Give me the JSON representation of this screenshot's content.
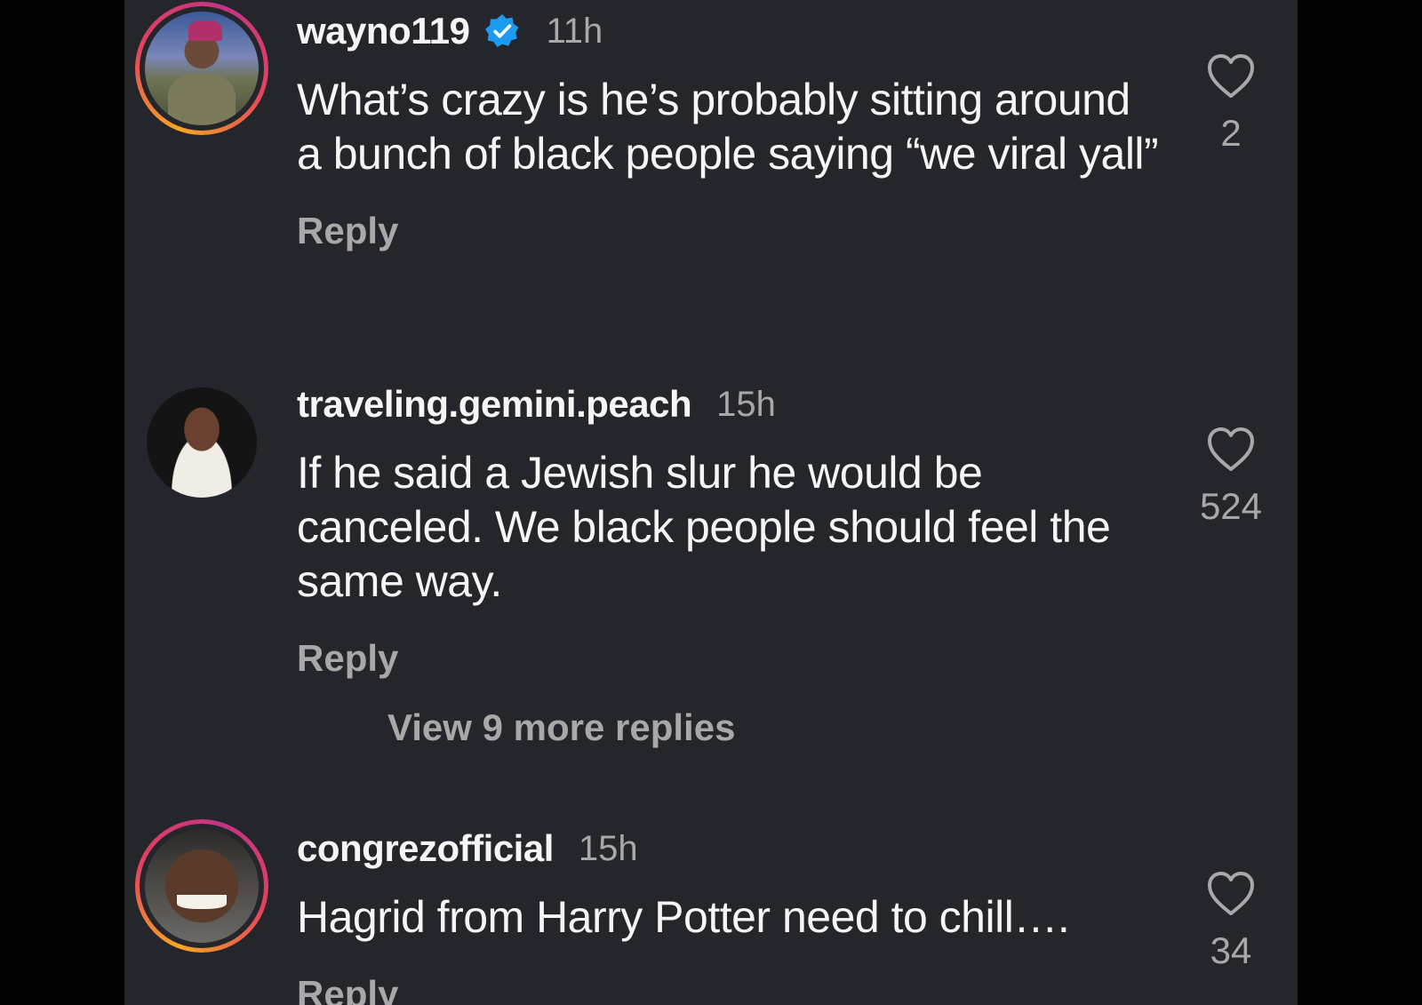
{
  "colors": {
    "background": "#24262b",
    "primary_text": "#f5f5f5",
    "secondary_text": "#a8a8a8",
    "verified_blue": "#1d9bf0"
  },
  "comments": [
    {
      "username": "wayno119",
      "verified": true,
      "time": "11h",
      "text": "What’s crazy is he’s probably sitting around a bunch of black people saying “we viral yall”",
      "reply_label": "Reply",
      "likes": "2",
      "avatar_icon": "profile-photo"
    },
    {
      "username": "traveling.gemini.peach",
      "verified": false,
      "time": "15h",
      "text": "If he said a Jewish slur he would be canceled. We black people should feel the same way.",
      "reply_label": "Reply",
      "likes": "524",
      "avatar_icon": "profile-photo"
    },
    {
      "username": "congrezofficial",
      "verified": false,
      "time": "15h",
      "text": "Hagrid from Harry Potter need to chill….",
      "reply_label": "Reply",
      "likes": "34",
      "avatar_icon": "profile-photo"
    }
  ],
  "view_more_replies": "View 9 more replies",
  "icons": {
    "like": "heart-outline-icon",
    "verified": "verified-badge-icon"
  }
}
